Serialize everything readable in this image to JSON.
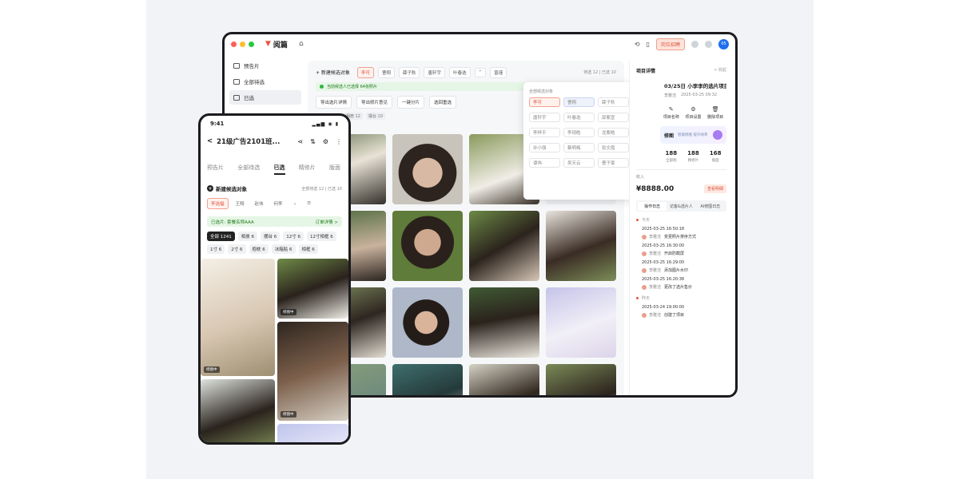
{
  "window": {
    "app_name": "阅篇",
    "promo_button": "岗位招聘"
  },
  "sidebar": {
    "items": [
      {
        "label": "预告片"
      },
      {
        "label": "全部待选"
      },
      {
        "label": "已选"
      }
    ]
  },
  "candidates": {
    "new_label": "+ 新建候选对象",
    "chips": [
      "李可",
      "曹翔",
      "薛子秋",
      "唐轩宇",
      "叶春选",
      "曾瑾"
    ],
    "right_info": "待选 12 | 已选 10"
  },
  "status": {
    "text": "当前候选人已选择 64张照片"
  },
  "actions": [
    "导出选片详情",
    "导出修片意见",
    "一键分片",
    "选回重选"
  ],
  "filters": [
    "相册 12",
    "摆台 10"
  ],
  "dropdown": {
    "title": "全部候选对象",
    "chips": [
      "李可",
      "曹翔",
      "薛子秋",
      "唐轩宇",
      "叶春选",
      "邵紫宣",
      "李梓平",
      "李翊皓",
      "龙紫皓",
      "孙小强",
      "蔡明梅",
      "张文霞",
      "谭伟",
      "吴天云",
      "曹子豪",
      "李达"
    ]
  },
  "detail": {
    "header": "项目详情",
    "collapse": "> 收起",
    "title": "03/25日 小李李的选片项目",
    "meta_user": "李雅洁",
    "meta_time": "2025-03-25 09:32",
    "actions": [
      {
        "label": "项目名称",
        "icon": "✎"
      },
      {
        "label": "项目设置",
        "icon": "⚙"
      },
      {
        "label": "删除项目",
        "icon": "🗑"
      }
    ],
    "ai_title": "修图",
    "ai_sub": "智能修图 提升效率",
    "stats": [
      {
        "n": "188",
        "l": "全部图"
      },
      {
        "n": "188",
        "l": "精修片"
      },
      {
        "n": "168",
        "l": "版面"
      }
    ],
    "income_label": "收入",
    "income": "¥8888.00",
    "income_btn": "查看明细",
    "tabs": [
      "操作日志",
      "访客&选片人",
      "AI修图日志"
    ],
    "groups": [
      {
        "label": "今天",
        "logs": [
          {
            "time": "2025-03-25 16:50:18",
            "user": "李雅洁",
            "text": "变更照片排序方式"
          },
          {
            "time": "2025-03-25 16:30:00",
            "user": "李雅洁",
            "text": "开启防截屏"
          },
          {
            "time": "2025-03-25 16:29:00",
            "user": "李雅洁",
            "text": "添加图片水印"
          },
          {
            "time": "2025-03-25 16:20:38",
            "user": "李雅洁",
            "text": "更改了选片售价"
          }
        ]
      },
      {
        "label": "昨天",
        "logs": [
          {
            "time": "2025-03-24 19:00:00",
            "user": "李雅洁",
            "text": "创建了项目"
          }
        ]
      }
    ]
  },
  "phone": {
    "time": "9:41",
    "signal": "▂▄▆ ◉ ▮",
    "title": "21级广告2101班...",
    "tabs": [
      "预告片",
      "全部待选",
      "已选",
      "精修片",
      "版面"
    ],
    "cand_label": "新建候选对象",
    "cand_right": "全部待选 12 | 已选 10",
    "chips": [
      "李选福",
      "王翔",
      "赵伟",
      "何李"
    ],
    "status_text": "已选片: 套餐名称AAA",
    "status_link": "订单详情 >",
    "filters": [
      "全部 1241",
      "相册 6",
      "摆台 6",
      "12寸 6",
      "12寸相框 6",
      "1寸 6",
      "2寸 6",
      "抱枕 6",
      "冰箱贴 6",
      "相框 6"
    ],
    "ai_tag": "修图中"
  }
}
